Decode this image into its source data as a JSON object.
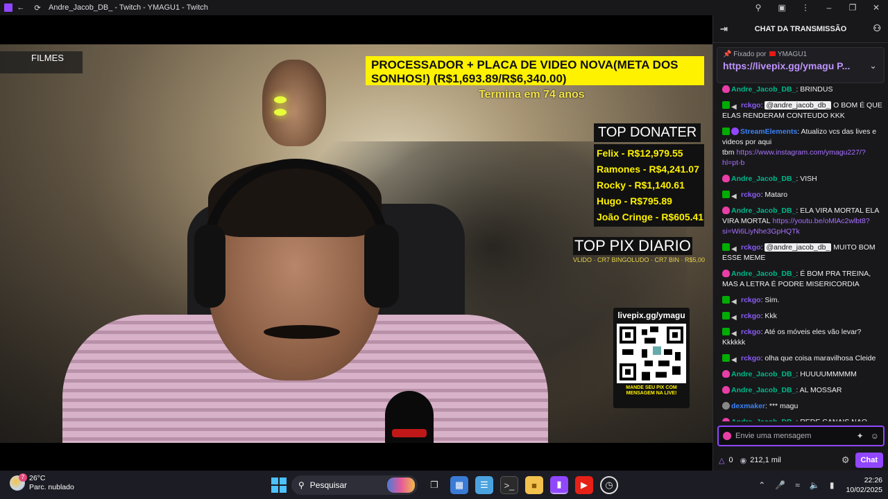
{
  "window": {
    "title": "Andre_Jacob_DB_ - Twitch - YMAGU1 - Twitch"
  },
  "stream_overlay": {
    "filmes_label": "FILMES",
    "goal_text": "PROCESSADOR + PLACA DE VIDEO NOVA(META DOS SONHOS!) (R$1,693.89/R$6,340.00)",
    "goal_ends": "Termina em 74 anos",
    "top_donater_title": "TOP DONATER",
    "top_donaters": [
      "Felix - R$12,979.55",
      "Ramones - R$4,241.07",
      "Rocky - R$1,140.61",
      "Hugo - R$795.89",
      "João Cringe - R$605.41"
    ],
    "top_pix_title": "TOP PIX DIARIO",
    "top_pix_ticker": "VLIDO · CR7 BINGOLUDO · CR7 BIN · R$5,00",
    "qr_url": "livepix.gg/ymagu",
    "qr_caption": "MANDE SEU PIX COM MENSAGEM NA LIVE!"
  },
  "chat": {
    "header_title": "CHAT DA TRANSMISSÃO",
    "pinned_by": "Fixado por",
    "pinned_by_user": "YMAGU1",
    "pinned_link": "https://livepix.gg/ymagu P...",
    "messages": [
      {
        "user": "Andre_Jacob_DB_",
        "color": "#00b88a",
        "badges": [
          "sub"
        ],
        "text": ": BRINDUS"
      },
      {
        "user": "rckgo",
        "color": "#8a5cf5",
        "badges": [
          "mod",
          "mute"
        ],
        "mention": "@andre_jacob_db_",
        "text": " O BOM É QUE ELAS RENDERAM CONTEUDO KKK"
      },
      {
        "user": "StreamElements",
        "color": "#3b82f6",
        "badges": [
          "mod",
          "bot"
        ],
        "text": ": Atualizo vcs das lives e videos por aqui tbm",
        "link": "https://www.instagram.com/ymagu227/?hl=pt-b"
      },
      {
        "user": "Andre_Jacob_DB_",
        "color": "#00b88a",
        "badges": [
          "sub"
        ],
        "text": ": VISH"
      },
      {
        "user": "rckgo",
        "color": "#8a5cf5",
        "badges": [
          "mod",
          "mute"
        ],
        "text": ": Mataro"
      },
      {
        "user": "Andre_Jacob_DB_",
        "color": "#00b88a",
        "badges": [
          "sub"
        ],
        "text": ": ELA VIRA MORTAL ELA VIRA MORTAL",
        "link": "https://youtu.be/oMlAc2wlbt8?si=Wi6LiyNhe3GpHQTk"
      },
      {
        "user": "rckgo",
        "color": "#8a5cf5",
        "badges": [
          "mod",
          "mute"
        ],
        "mention": "@andre_jacob_db_",
        "text": " MUITO BOM ESSE MEME"
      },
      {
        "user": "Andre_Jacob_DB_",
        "color": "#00b88a",
        "badges": [
          "sub"
        ],
        "text": ": É BOM PRA TREINA, MAS A LETRA É PODRE MISERICORDIA"
      },
      {
        "user": "rckgo",
        "color": "#8a5cf5",
        "badges": [
          "mod",
          "mute"
        ],
        "text": ": Sim."
      },
      {
        "user": "rckgo",
        "color": "#8a5cf5",
        "badges": [
          "mod",
          "mute"
        ],
        "text": ": Kkk"
      },
      {
        "user": "rckgo",
        "color": "#8a5cf5",
        "badges": [
          "mod",
          "mute"
        ],
        "text": ": Até os móveis eles vão levar? Kkkkkk"
      },
      {
        "user": "rckgo",
        "color": "#8a5cf5",
        "badges": [
          "mod",
          "mute"
        ],
        "text": ": olha que coisa maravilhosa Cleide"
      },
      {
        "user": "Andre_Jacob_DB_",
        "color": "#00b88a",
        "badges": [
          "sub"
        ],
        "text": ": HUUUUMMMMM"
      },
      {
        "user": "Andre_Jacob_DB_",
        "color": "#00b88a",
        "badges": [
          "sub"
        ],
        "text": ": AL MOSSAR"
      },
      {
        "user": "dexmaker",
        "color": "#3b82f6",
        "badges": [
          "avatar"
        ],
        "text": ": *** magu"
      },
      {
        "user": "Andre_Jacob_DB_",
        "color": "#00b88a",
        "badges": [
          "sub"
        ],
        "text": ": REDE CANAIS NAO TEM?"
      }
    ],
    "input_placeholder": "Envie uma mensagem",
    "points": "0",
    "viewers": "212,1 mil",
    "chat_button": "Chat"
  },
  "taskbar": {
    "weather_temp": "26°C",
    "weather_desc": "Parc. nublado",
    "weather_badge": "7",
    "search_placeholder": "Pesquisar",
    "time": "22:26",
    "date": "10/02/2025"
  }
}
